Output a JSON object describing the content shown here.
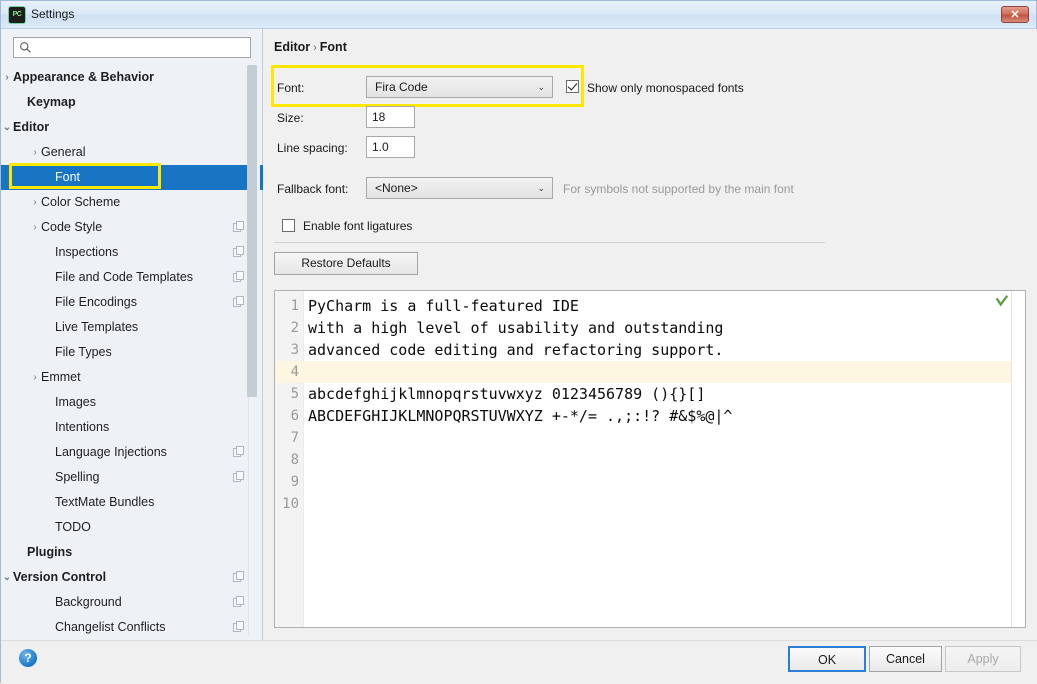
{
  "window": {
    "title": "Settings",
    "app_icon": "pycharm-icon",
    "close_label": "✕"
  },
  "search": {
    "placeholder": "",
    "value": "",
    "icon": "search-icon"
  },
  "sidebar": {
    "items": [
      {
        "label": "Appearance & Behavior",
        "indent": 12,
        "arrow": "›",
        "bold": true,
        "selected": false,
        "copy": false
      },
      {
        "label": "Keymap",
        "indent": 26,
        "arrow": "",
        "bold": true,
        "selected": false,
        "copy": false
      },
      {
        "label": "Editor",
        "indent": 12,
        "arrow": "⌄",
        "bold": true,
        "selected": false,
        "copy": false
      },
      {
        "label": "General",
        "indent": 40,
        "arrow": "›",
        "bold": false,
        "selected": false,
        "copy": false
      },
      {
        "label": "Font",
        "indent": 54,
        "arrow": "",
        "bold": false,
        "selected": true,
        "copy": false
      },
      {
        "label": "Color Scheme",
        "indent": 40,
        "arrow": "›",
        "bold": false,
        "selected": false,
        "copy": false
      },
      {
        "label": "Code Style",
        "indent": 40,
        "arrow": "›",
        "bold": false,
        "selected": false,
        "copy": true
      },
      {
        "label": "Inspections",
        "indent": 54,
        "arrow": "",
        "bold": false,
        "selected": false,
        "copy": true
      },
      {
        "label": "File and Code Templates",
        "indent": 54,
        "arrow": "",
        "bold": false,
        "selected": false,
        "copy": true
      },
      {
        "label": "File Encodings",
        "indent": 54,
        "arrow": "",
        "bold": false,
        "selected": false,
        "copy": true
      },
      {
        "label": "Live Templates",
        "indent": 54,
        "arrow": "",
        "bold": false,
        "selected": false,
        "copy": false
      },
      {
        "label": "File Types",
        "indent": 54,
        "arrow": "",
        "bold": false,
        "selected": false,
        "copy": false
      },
      {
        "label": "Emmet",
        "indent": 40,
        "arrow": "›",
        "bold": false,
        "selected": false,
        "copy": false
      },
      {
        "label": "Images",
        "indent": 54,
        "arrow": "",
        "bold": false,
        "selected": false,
        "copy": false
      },
      {
        "label": "Intentions",
        "indent": 54,
        "arrow": "",
        "bold": false,
        "selected": false,
        "copy": false
      },
      {
        "label": "Language Injections",
        "indent": 54,
        "arrow": "",
        "bold": false,
        "selected": false,
        "copy": true
      },
      {
        "label": "Spelling",
        "indent": 54,
        "arrow": "",
        "bold": false,
        "selected": false,
        "copy": true
      },
      {
        "label": "TextMate Bundles",
        "indent": 54,
        "arrow": "",
        "bold": false,
        "selected": false,
        "copy": false
      },
      {
        "label": "TODO",
        "indent": 54,
        "arrow": "",
        "bold": false,
        "selected": false,
        "copy": false
      },
      {
        "label": "Plugins",
        "indent": 26,
        "arrow": "",
        "bold": true,
        "selected": false,
        "copy": false
      },
      {
        "label": "Version Control",
        "indent": 12,
        "arrow": "⌄",
        "bold": true,
        "selected": false,
        "copy": true
      },
      {
        "label": "Background",
        "indent": 54,
        "arrow": "",
        "bold": false,
        "selected": false,
        "copy": true
      },
      {
        "label": "Changelist Conflicts",
        "indent": 54,
        "arrow": "",
        "bold": false,
        "selected": false,
        "copy": true
      }
    ],
    "selected_index": 4
  },
  "main": {
    "breadcrumb": {
      "root": "Editor",
      "separator": "›",
      "leaf": "Font"
    },
    "font_row": {
      "label": "Font:",
      "value": "Fira Code",
      "chevron": "⌄",
      "checkbox_label": "Show only monospaced fonts",
      "checkbox_checked": true
    },
    "size_row": {
      "label": "Size:",
      "value": "18"
    },
    "spacing_row": {
      "label": "Line spacing:",
      "value": "1.0"
    },
    "fallback_row": {
      "label": "Fallback font:",
      "value": "<None>",
      "chevron": "⌄",
      "hint": "For symbols not supported by the main font"
    },
    "ligatures": {
      "label": "Enable font ligatures",
      "checked": false
    },
    "restore_defaults": "Restore Defaults"
  },
  "preview": {
    "lines": [
      {
        "no": "1",
        "text": "PyCharm is a full-featured IDE",
        "highlight": false
      },
      {
        "no": "2",
        "text": "with a high level of usability and outstanding",
        "highlight": false
      },
      {
        "no": "3",
        "text": "advanced code editing and refactoring support.",
        "highlight": false
      },
      {
        "no": "4",
        "text": "",
        "highlight": true
      },
      {
        "no": "5",
        "text": "abcdefghijklmnopqrstuvwxyz 0123456789 (){}[]",
        "highlight": false
      },
      {
        "no": "6",
        "text": "ABCDEFGHIJKLMNOPQRSTUVWXYZ +-*/= .,;:!? #&$%@|^",
        "highlight": false
      },
      {
        "no": "7",
        "text": "",
        "highlight": false
      },
      {
        "no": "8",
        "text": "",
        "highlight": false
      },
      {
        "no": "9",
        "text": "",
        "highlight": false
      },
      {
        "no": "10",
        "text": "",
        "highlight": false
      }
    ],
    "status_icon": "green-check-icon"
  },
  "footer": {
    "help": "?",
    "ok": "OK",
    "cancel": "Cancel",
    "apply": "Apply",
    "apply_disabled": true
  },
  "colors": {
    "selection_blue": "#1775c4",
    "highlight_yellow": "#ffe800",
    "caret_line": "#fdf6e0",
    "accent_focus": "#2a7fd4"
  }
}
